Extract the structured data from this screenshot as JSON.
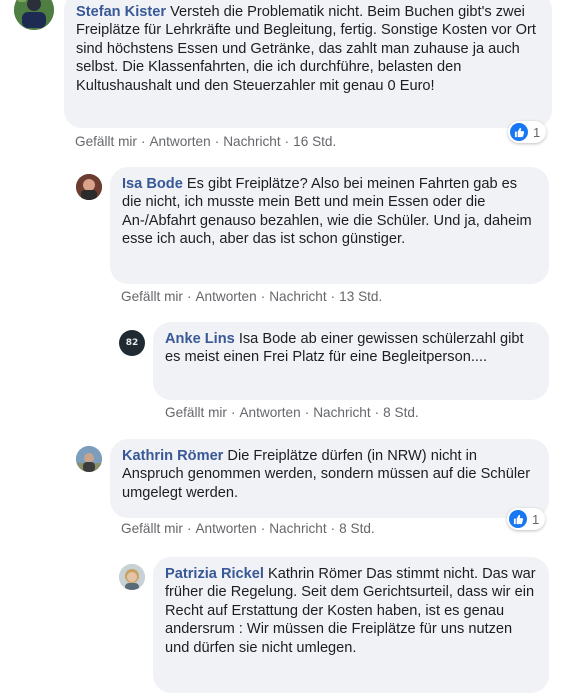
{
  "comments": [
    {
      "author": "Stefan Kister",
      "text": "Versteh die Problematik nicht. Beim Buchen gibt's zwei Freiplätze für Lehrkräfte und Begleitung, fertig. Sonstige Kosten vor Ort sind höchstens Essen und Getränke, das zahlt man zuhause ja auch selbst. Die Klassenfahrten, die ich durchführe, belasten den Kultushaushalt und den Steuerzahler mit genau 0 Euro!",
      "like": "Gefällt mir",
      "reply": "Antworten",
      "message": "Nachricht",
      "time": "16 Std.",
      "reactions": "1"
    },
    {
      "author": "Isa Bode",
      "text": "Es gibt Freiplätze? Also bei meinen Fahrten gab es die nicht, ich musste mein Bett und mein Essen oder die An-/Abfahrt genauso bezahlen, wie die Schüler. Und ja, daheim esse ich auch, aber das ist schon günstiger.",
      "like": "Gefällt mir",
      "reply": "Antworten",
      "message": "Nachricht",
      "time": "13 Std."
    },
    {
      "author": "Anke Lins",
      "text": "Isa Bode ab einer gewissen schülerzahl gibt es meist einen Frei Platz für eine Begleitperson....",
      "like": "Gefällt mir",
      "reply": "Antworten",
      "message": "Nachricht",
      "time": "8 Std.",
      "avatar_text": "82"
    },
    {
      "author": "Kathrin Römer",
      "text": "Die Freiplätze dürfen (in NRW) nicht in Anspruch genommen werden, sondern müssen auf die Schüler umgelegt werden.",
      "like": "Gefällt mir",
      "reply": "Antworten",
      "message": "Nachricht",
      "time": "8 Std.",
      "reactions": "1"
    },
    {
      "author": "Patrizia Rickel",
      "text": "Kathrin Römer Das stimmt nicht. Das war früher die Regelung. Seit dem Gerichtsurteil, dass wir ein Recht auf Erstattung der Kosten haben, ist es genau andersrum : Wir müssen die Freiplätze für uns nutzen und dürfen sie nicht umlegen."
    }
  ],
  "icons": {
    "reaction": "like-thumb-icon"
  },
  "colors": {
    "author": "#385898",
    "bubble": "#f0f2f5",
    "meta": "#65676b",
    "like": "#1877f2"
  }
}
